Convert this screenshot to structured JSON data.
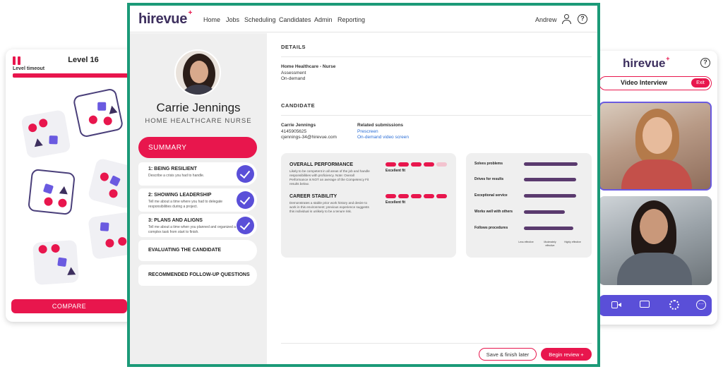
{
  "game_card": {
    "level": "Level 16",
    "timeout_label": "Level timeout",
    "timeout_progress": 1.0,
    "compare_label": "COMPARE"
  },
  "video_card": {
    "logo": "hirevue",
    "logo_mark": "+",
    "help_glyph": "?",
    "title": "Video Interview",
    "exit_label": "Exit",
    "toolbar_icons": [
      "video-camera-icon",
      "chat-icon",
      "gear-icon",
      "more-icon"
    ],
    "more_glyph": "···"
  },
  "nav": {
    "logo": "hirevue",
    "logo_mark": "+",
    "items": [
      "Home",
      "Jobs",
      "Scheduling",
      "Candidates",
      "Admin",
      "Reporting"
    ],
    "user": "Andrew",
    "help_glyph": "?"
  },
  "candidate": {
    "name": "Carrie Jennings",
    "role": "HOME HEALTHCARE NURSE"
  },
  "sidebar": {
    "summary_label": "SUMMARY",
    "competencies": [
      {
        "title": "1: BEING RESILIENT",
        "desc": "Describe a crisis you had to handle."
      },
      {
        "title": "2: SHOWING LEADERSHIP",
        "desc": "Tell me about a time where you had to delegate responsibilities during a project."
      },
      {
        "title": "3: PLANS AND ALIGNS",
        "desc": "Tell me about a time when you planned and organized a complex task from start to finish."
      }
    ],
    "evaluating_label": "EVALUATING THE CANDIDATE",
    "followup_label": "RECOMMENDED FOLLOW-UP QUESTIONS"
  },
  "details": {
    "heading": "DETAILS",
    "position": "Home Healthcare - Nurse",
    "type": "Assessment",
    "mode": "On-demand"
  },
  "candidate_section": {
    "heading": "CANDIDATE",
    "name": "Carrie Jennings",
    "phone": "4145905625",
    "email": "cjennings-34@hirevue.com",
    "related_heading": "Related submissions",
    "related": [
      "Prescreen",
      "On-demand video screen"
    ]
  },
  "performance": {
    "overall_title": "OVERALL PERFORMANCE",
    "overall_desc": "Likely to be competent in all areas of the job and handle responsibilities with proficiency. Note: Overall Performance is NOT an average of the Competency Fit results below.",
    "overall_fit": "Excellent fit",
    "overall_score": 4,
    "stability_title": "CAREER STABILITY",
    "stability_desc": "Demonstrates a stable prior work history and desire to work in this environment; previous experience suggests this individual is unlikely to be a tenure risk.",
    "stability_fit": "Excellent fit",
    "stability_score": 5,
    "max_score": 5
  },
  "behaviors": {
    "items": [
      {
        "label": "Solves problems",
        "level": 0.95
      },
      {
        "label": "Drives for results",
        "level": 0.93
      },
      {
        "label": "Exceptional service",
        "level": 0.93
      },
      {
        "label": "Works well with others",
        "level": 0.72
      },
      {
        "label": "Follows procedures",
        "level": 0.88
      }
    ],
    "scale": [
      "Less effective",
      "Moderately effective",
      "Highly effective"
    ]
  },
  "footer": {
    "save_label": "Save & finish later",
    "begin_label": "Begin review +"
  },
  "colors": {
    "brand_pink": "#e8164d",
    "brand_purple": "#5a4fd8",
    "frame_green": "#1b9a78",
    "logo_navy": "#3d2f5e"
  }
}
